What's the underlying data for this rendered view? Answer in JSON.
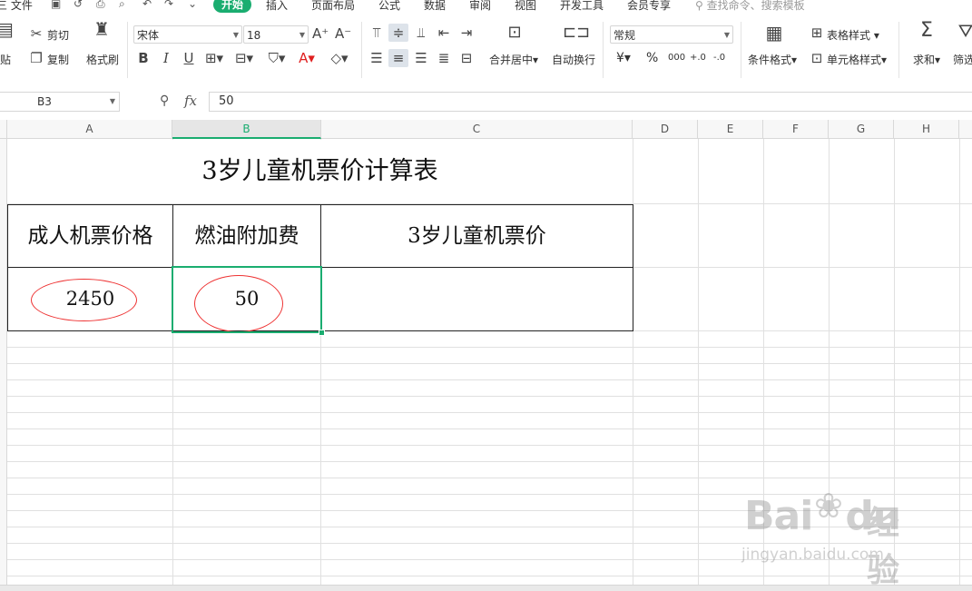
{
  "menubar": {
    "file_menu": "三 文件",
    "tabs": [
      "开始",
      "插入",
      "页面布局",
      "公式",
      "数据",
      "审阅",
      "视图",
      "开发工具",
      "会员专享"
    ],
    "active_tab": "开始",
    "search_placeholder": "查找命令、搜索模板"
  },
  "ribbon": {
    "paste_label": "贴",
    "cut_label": "剪切",
    "copy_label": "复制",
    "format_painter_label": "格式刷",
    "font_name": "宋体",
    "font_size": "18",
    "merge_label": "合并居中",
    "wrap_label": "自动换行",
    "number_format": "常规",
    "table_style_label": "表格样式",
    "cell_style_label": "单元格样式",
    "cond_format_label": "条件格式",
    "sum_label": "求和",
    "filter_label": "筛选",
    "currency_symbol": "¥",
    "percent_symbol": "%",
    "thousands_symbol": "000",
    "inc_decimal": "+.0",
    "dec_decimal": "-.0"
  },
  "formula_bar": {
    "cell_ref": "B3",
    "fx": "fx",
    "value": "50"
  },
  "columns": [
    "A",
    "B",
    "C",
    "D",
    "E",
    "F",
    "G",
    "H"
  ],
  "selected_column": "B",
  "sheet": {
    "title": "3岁儿童机票价计算表",
    "headers": [
      "成人机票价格",
      "燃油附加费",
      "3岁儿童机票价"
    ],
    "values": [
      "2450",
      "50",
      ""
    ]
  },
  "watermark": {
    "logo": "Bai",
    "logo_tail": "du",
    "cn": "经验",
    "url": "jingyan.baidu.com"
  },
  "colors": {
    "accent": "#1aad70",
    "annotation": "#ee3333"
  }
}
